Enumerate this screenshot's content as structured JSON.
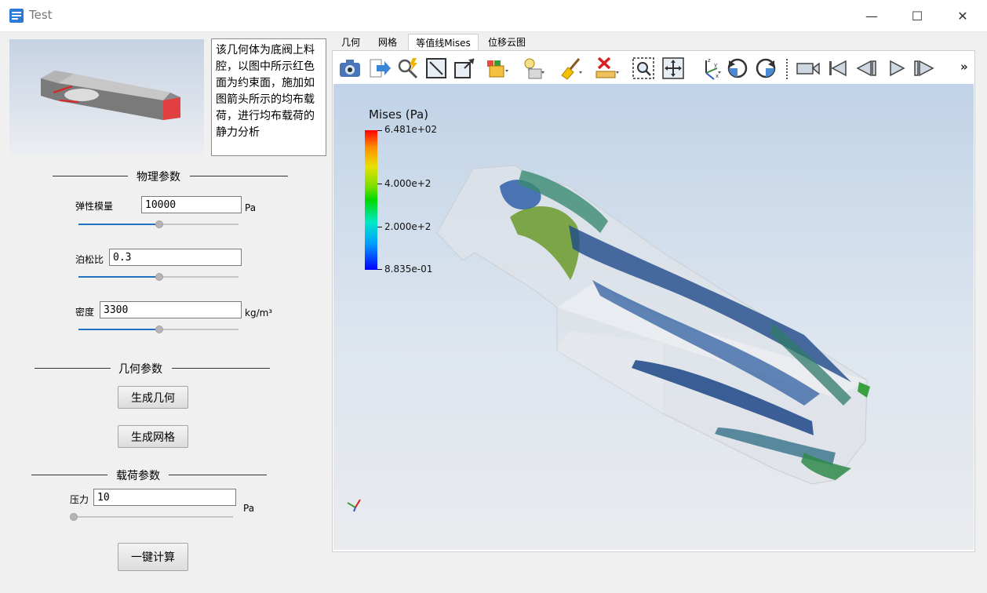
{
  "window": {
    "title": "Test",
    "minimize": "—",
    "maximize": "☐",
    "close": "✕"
  },
  "description": "该几何体为底阀上料腔，以图中所示红色面为约束面，施加如图箭头所示的均布载荷，进行均布载荷的静力分析",
  "physics": {
    "section_title": "物理参数",
    "elastic": {
      "label": "弹性模量",
      "value": "10000",
      "unit": "Pa",
      "slider": 0.5
    },
    "poisson": {
      "label": "泊松比",
      "value": "0.3",
      "slider": 0.5
    },
    "density": {
      "label": "密度",
      "value": "3300",
      "unit": "kg/m³",
      "slider": 0.5
    }
  },
  "geometry": {
    "section_title": "几何参数",
    "gen_geometry": "生成几何",
    "gen_mesh": "生成网格"
  },
  "load": {
    "section_title": "载荷参数",
    "pressure": {
      "label": "压力",
      "value": "10",
      "unit": "Pa",
      "slider": 0.0
    }
  },
  "compute_button": "一键计算",
  "tabs": [
    {
      "label": "几何",
      "active": false
    },
    {
      "label": "网格",
      "active": false
    },
    {
      "label": "等值线Mises",
      "active": true
    },
    {
      "label": "位移云图",
      "active": false
    }
  ],
  "toolbar": {
    "more": "»"
  },
  "legend": {
    "title": "Mises (Pa)",
    "max": "6.481e+02",
    "mid_high": "4.000e+2",
    "mid_low": "2.000e+2",
    "min": "8.835e-01",
    "colors": [
      "#ff0000",
      "#ff8c00",
      "#e8e000",
      "#7ee000",
      "#00d800",
      "#00e8c8",
      "#0099ff",
      "#0000ff"
    ]
  }
}
